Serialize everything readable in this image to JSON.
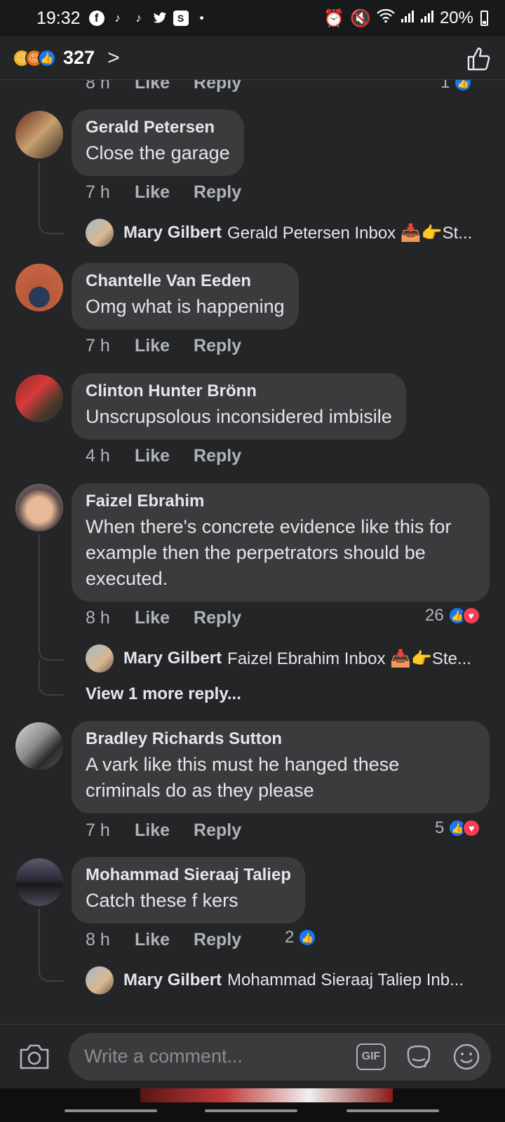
{
  "status_bar": {
    "time": "19:32",
    "app_icons": [
      "facebook-icon",
      "tiktok-icon",
      "tiktok-icon",
      "twitter-icon",
      "s-icon"
    ],
    "battery": "20%"
  },
  "reactions_header": {
    "count": "327",
    "icons": [
      "sad",
      "angry",
      "like"
    ]
  },
  "top_partial": {
    "time": "8 h",
    "like": "Like",
    "reply": "Reply",
    "count": "1"
  },
  "comments": [
    {
      "name": "Gerald Petersen",
      "text": "Close the garage",
      "time": "7 h",
      "like": "Like",
      "reply": "Reply",
      "reply_preview": {
        "name": "Mary Gilbert",
        "text": "Gerald Petersen Inbox 📥👉St..."
      }
    },
    {
      "name": "Chantelle Van Eeden",
      "text": "Omg what is happening",
      "time": "7 h",
      "like": "Like",
      "reply": "Reply"
    },
    {
      "name": "Clinton Hunter Brönn",
      "text": "Unscrupsolous inconsidered imbisile",
      "time": "4 h",
      "like": "Like",
      "reply": "Reply"
    },
    {
      "name": "Faizel Ebrahim",
      "text": "When there's concrete evidence like this for example then the perpetrators should be executed.",
      "time": "8 h",
      "like": "Like",
      "reply": "Reply",
      "reactions": "26",
      "reply_preview": {
        "name": "Mary Gilbert",
        "text": "Faizel Ebrahim Inbox 📥👉Ste..."
      },
      "view_more": "View 1 more reply..."
    },
    {
      "name": "Bradley Richards Sutton",
      "text": "A vark like this must he hanged these criminals do as they please",
      "time": "7 h",
      "like": "Like",
      "reply": "Reply",
      "reactions": "5"
    },
    {
      "name": "Mohammad Sieraaj Taliep",
      "text": "Catch these f kers",
      "time": "8 h",
      "like": "Like",
      "reply": "Reply",
      "reactions": "2",
      "reply_preview": {
        "name": "Mary Gilbert",
        "text": "Mohammad Sieraaj Taliep Inb..."
      }
    }
  ],
  "composer": {
    "placeholder": "Write a comment...",
    "gif_label": "GIF"
  },
  "colors": {
    "like_blue": "#1877f2",
    "love_red": "#f33e58",
    "bubble": "#3a3b3c",
    "background": "#242526"
  }
}
